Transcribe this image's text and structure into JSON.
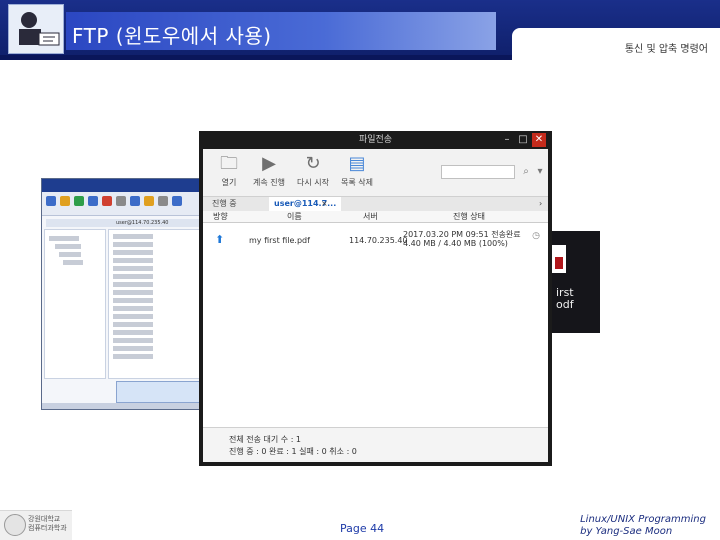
{
  "slide": {
    "title": "FTP (윈도우에서 사용)",
    "section": "통신 및 압축 명령어",
    "page": "Page 44",
    "course_line1": "Linux/UNIX Programming",
    "course_line2": "by Yang-Sae Moon",
    "university_line1": "강원대학교",
    "university_line2": "컴퓨터과학과"
  },
  "dialog": {
    "title": "파일전송",
    "minimize": "–",
    "restore": "□",
    "close": "✕",
    "toolbar": [
      {
        "label": "열기",
        "icon": "folder-icon"
      },
      {
        "label": "계속 진행",
        "icon": "play-icon"
      },
      {
        "label": "다시 시작",
        "icon": "refresh-icon"
      },
      {
        "label": "목록 삭제",
        "icon": "trash-icon"
      }
    ],
    "tabs": [
      "진행 중",
      "user@114.7..."
    ],
    "columns": [
      "방향",
      "이름",
      "서버",
      "진행 상태"
    ],
    "rows": [
      {
        "name": "my first file.pdf",
        "server": "114.70.235.40",
        "status_line1": "2017.03.20 PM 09:51 전송완료",
        "status_line2": "4.40 MB / 4.40 MB (100%)"
      }
    ],
    "footer": {
      "line1": "전체 전송 대기 수 : 1",
      "line2": "진행 중 : 0   완료 : 1   실패 : 0   취소 : 0"
    }
  },
  "bg_window": {
    "path": "user@114.70.235.40",
    "dark_text_line1": "irst",
    "dark_text_line2": "odf"
  }
}
